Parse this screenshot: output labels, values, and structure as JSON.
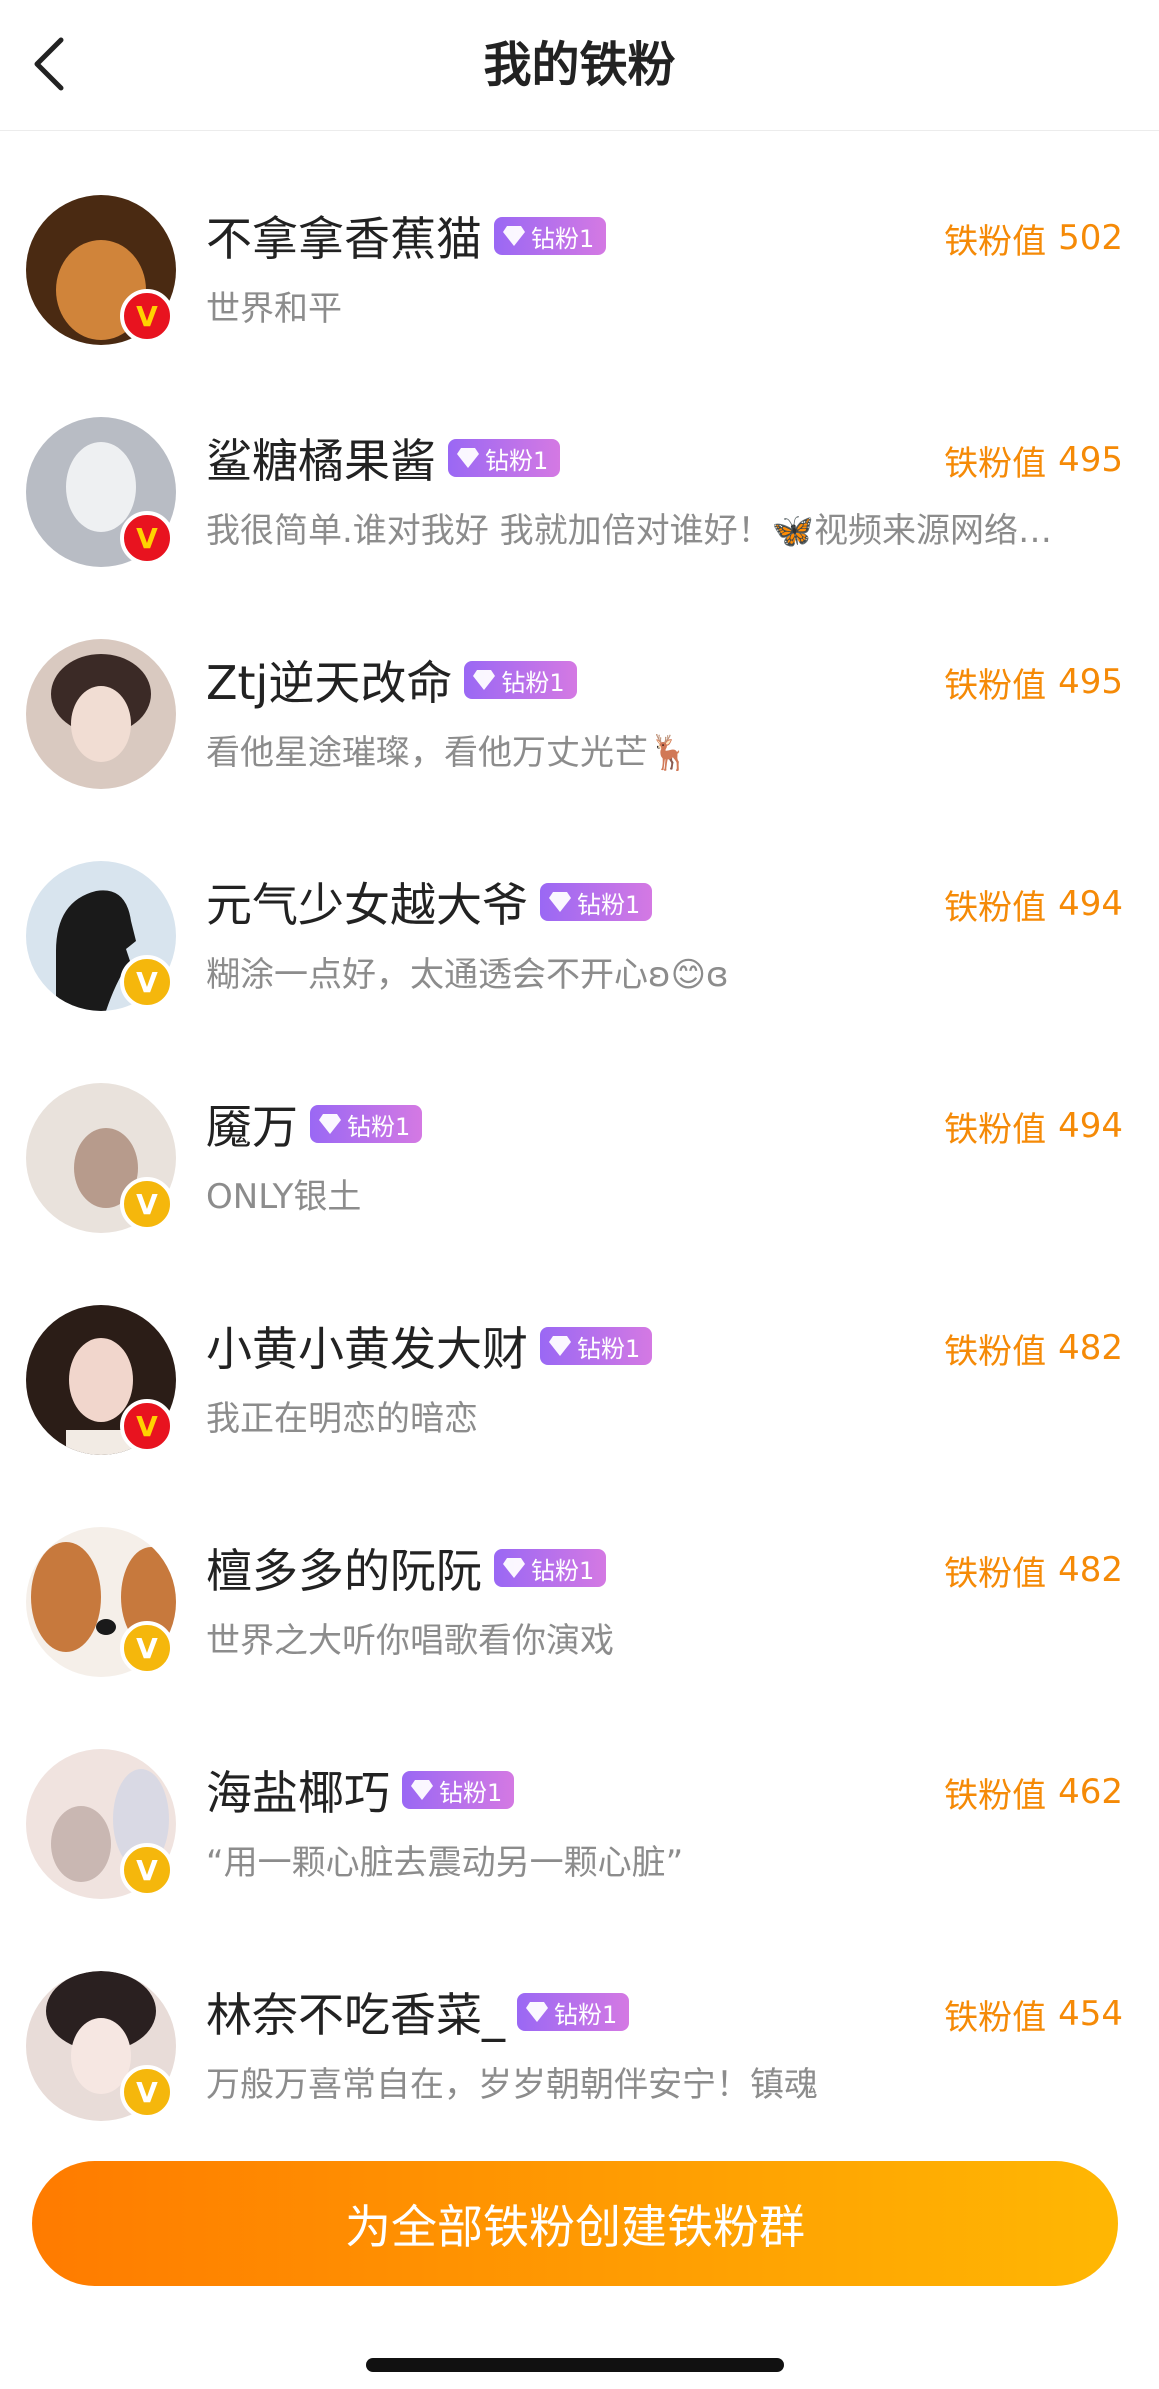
{
  "header": {
    "title": "我的铁粉"
  },
  "fans": [
    {
      "name": "不拿拿香蕉猫",
      "badge": "钻粉1",
      "score_label": "铁粉值",
      "score": "502",
      "bio": "世界和平",
      "verify": "red",
      "avatar_colors": [
        "#4a2a12",
        "#d0843a"
      ]
    },
    {
      "name": "鲨糖橘果酱",
      "badge": "钻粉1",
      "score_label": "铁粉值",
      "score": "495",
      "bio": "我很简单.谁对我好 我就加倍对谁好！🦋视频来源网络…",
      "verify": "red",
      "avatar_colors": [
        "#b8bcc4",
        "#eef0f2"
      ]
    },
    {
      "name": "Ztj逆天改命",
      "badge": "钻粉1",
      "score_label": "铁粉值",
      "score": "495",
      "bio": "看他星途璀璨，看他万丈光芒🦌",
      "verify": "none",
      "avatar_colors": [
        "#d9c9c0",
        "#3b2a26"
      ]
    },
    {
      "name": "元气少女越大爷",
      "badge": "钻粉1",
      "score_label": "铁粉值",
      "score": "494",
      "bio": "糊涂一点好，太通透会不开心ʚ😊ɞ",
      "verify": "gold",
      "avatar_colors": [
        "#1a1a1a",
        "#d8e4ee"
      ]
    },
    {
      "name": "魇万",
      "badge": "钻粉1",
      "score_label": "铁粉值",
      "score": "494",
      "bio": "ONLY银土",
      "verify": "gold",
      "avatar_colors": [
        "#e9e2dc",
        "#b79b8c"
      ]
    },
    {
      "name": "小黄小黄发大财",
      "badge": "钻粉1",
      "score_label": "铁粉值",
      "score": "482",
      "bio": "我正在明恋的暗恋",
      "verify": "red",
      "avatar_colors": [
        "#2b1d17",
        "#f1d6cc"
      ]
    },
    {
      "name": "檀多多的阮阮",
      "badge": "钻粉1",
      "score_label": "铁粉值",
      "score": "482",
      "bio": "世界之大听你唱歌看你演戏",
      "verify": "gold",
      "avatar_colors": [
        "#c7793d",
        "#f5efe9"
      ]
    },
    {
      "name": "海盐椰巧",
      "badge": "钻粉1",
      "score_label": "铁粉值",
      "score": "462",
      "bio": "“用一颗心脏去震动另一颗心脏”",
      "verify": "gold",
      "avatar_colors": [
        "#c9b7b2",
        "#f0e3df"
      ]
    },
    {
      "name": "林奈不吃香菜_",
      "badge": "钻粉1",
      "score_label": "铁粉值",
      "score": "454",
      "bio": "万般万喜常自在，岁岁朝朝伴安宁！镇魂",
      "verify": "gold",
      "avatar_colors": [
        "#e8dcd8",
        "#2a2020"
      ]
    }
  ],
  "bottom": {
    "cta_label": "为全部铁粉创建铁粉群"
  },
  "colors": {
    "accent_orange": "#f58a07",
    "badge_purple": "#9a68f4",
    "verify_red": "#e8131f",
    "verify_gold": "#f5b70c"
  }
}
